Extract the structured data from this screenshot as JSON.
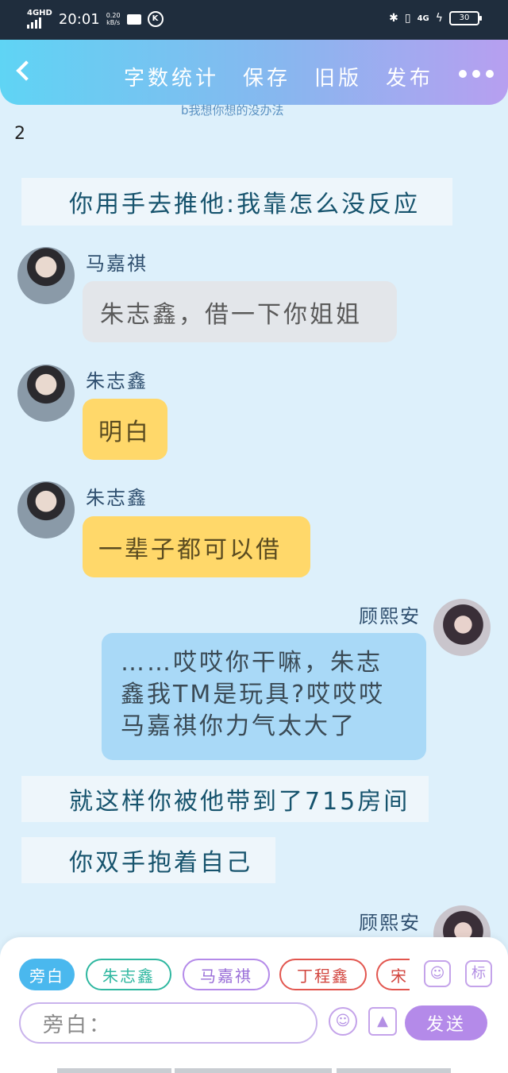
{
  "status_bar": {
    "network": "4GHD",
    "time": "20:01",
    "speed": "0.20",
    "speed_unit": "kB/s",
    "k_icon": "K",
    "bluetooth_icon": "bluetooth-icon",
    "vibrate_icon": "vibrate-icon",
    "signal_label": "4G",
    "battery": "30"
  },
  "header": {
    "word_count": "字数统计",
    "save": "保存",
    "old_version": "旧版",
    "publish": "发布",
    "peek_text": "b我想你想的没办法"
  },
  "page_number": "2",
  "messages": [
    {
      "type": "narration",
      "text": "你用手去推他:我靠怎么没反应"
    },
    {
      "type": "left",
      "name": "马嘉祺",
      "text": "朱志鑫，借一下你姐姐",
      "color": "#e3e6ea"
    },
    {
      "type": "left",
      "name": "朱志鑫",
      "text": "明白",
      "color": "#ffd86a"
    },
    {
      "type": "left",
      "name": "朱志鑫",
      "text": "一辈子都可以借",
      "color": "#ffd86a"
    },
    {
      "type": "right",
      "name": "顾熙安",
      "text": "……哎哎你干嘛，朱志鑫我TM是玩具?哎哎哎马嘉祺你力气太大了",
      "lines": [
        "……哎哎你干嘛，朱志",
        "鑫我TM是玩具?哎哎哎",
        "马嘉祺你力气太大了"
      ],
      "color": "#a9d9f7"
    },
    {
      "type": "narration",
      "text": "就这样你被他带到了715房间"
    },
    {
      "type": "narration",
      "text": "你双手抱着自己"
    },
    {
      "type": "right",
      "name": "顾熙安",
      "text": ""
    }
  ],
  "characters": [
    {
      "label": "旁白",
      "color": "#4ab8ee",
      "active": true
    },
    {
      "label": "朱志鑫",
      "color": "#2fb7a0",
      "active": false
    },
    {
      "label": "马嘉祺",
      "color": "#b48ae9",
      "active": false
    },
    {
      "label": "丁程鑫",
      "color": "#e2554e",
      "active": false
    },
    {
      "label": "宋",
      "color": "#e2554e",
      "active": false
    }
  ],
  "toolbar": {
    "character_icon": "person-card-icon",
    "tag_label": "标",
    "input_placeholder": "旁白：",
    "emoji_icon": "wink-emoji-icon",
    "image_icon": "image-icon",
    "send": "发送"
  }
}
